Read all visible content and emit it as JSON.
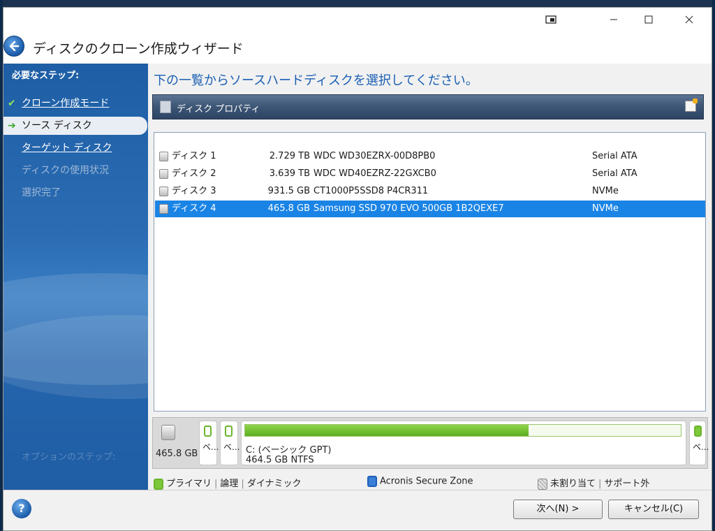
{
  "window": {
    "title": "ディスクのクローン作成ウィザード"
  },
  "sidebar": {
    "heading": "必要なステップ:",
    "steps": [
      {
        "label": "クローン作成モード",
        "state": "done"
      },
      {
        "label": "ソース ディスク",
        "state": "active"
      },
      {
        "label": "ターゲット ディスク",
        "state": "link"
      },
      {
        "label": "ディスクの使用状況",
        "state": "disabled"
      },
      {
        "label": "選択完了",
        "state": "disabled"
      }
    ],
    "optional_heading": "オプションのステップ:"
  },
  "main": {
    "instruction": "下の一覧からソースハードディスクを選択してください。",
    "toolbar_label": "ディスク プロパティ",
    "disks": [
      {
        "name": "ディスク 1",
        "size": "2.729 TB",
        "model": "WDC WD30EZRX-00D8PB0",
        "interface": "Serial ATA",
        "selected": false
      },
      {
        "name": "ディスク 2",
        "size": "3.639 TB",
        "model": "WDC WD40EZRZ-22GXCB0",
        "interface": "Serial ATA",
        "selected": false
      },
      {
        "name": "ディスク 3",
        "size": "931.5 GB",
        "model": "CT1000P5SSD8 P4CR311",
        "interface": "NVMe",
        "selected": false
      },
      {
        "name": "ディスク 4",
        "size": "465.8 GB",
        "model": "Samsung SSD 970 EVO 500GB 1B2QEXE7",
        "interface": "NVMe",
        "selected": true
      }
    ]
  },
  "disk_map": {
    "disk_size": "465.8 GB",
    "small_part_label": "ベ...",
    "main_partition": {
      "label": "C: (ベーシック GPT)",
      "info": "464.5 GB  NTFS",
      "usage_fraction": 0.65
    }
  },
  "legend": {
    "primary": "プライマリ",
    "logical": "論理",
    "dynamic": "ダイナミック",
    "secure_zone": "Acronis Secure Zone",
    "unallocated": "未割り当て",
    "unsupported": "サポート外"
  },
  "footer": {
    "next_label": "次へ(N) >",
    "cancel_label": "キャンセル(C)",
    "help_glyph": "?"
  },
  "colors": {
    "accent": "#1a5fb4",
    "selection": "#1a84e6",
    "partition_green": "#6bb52c"
  }
}
